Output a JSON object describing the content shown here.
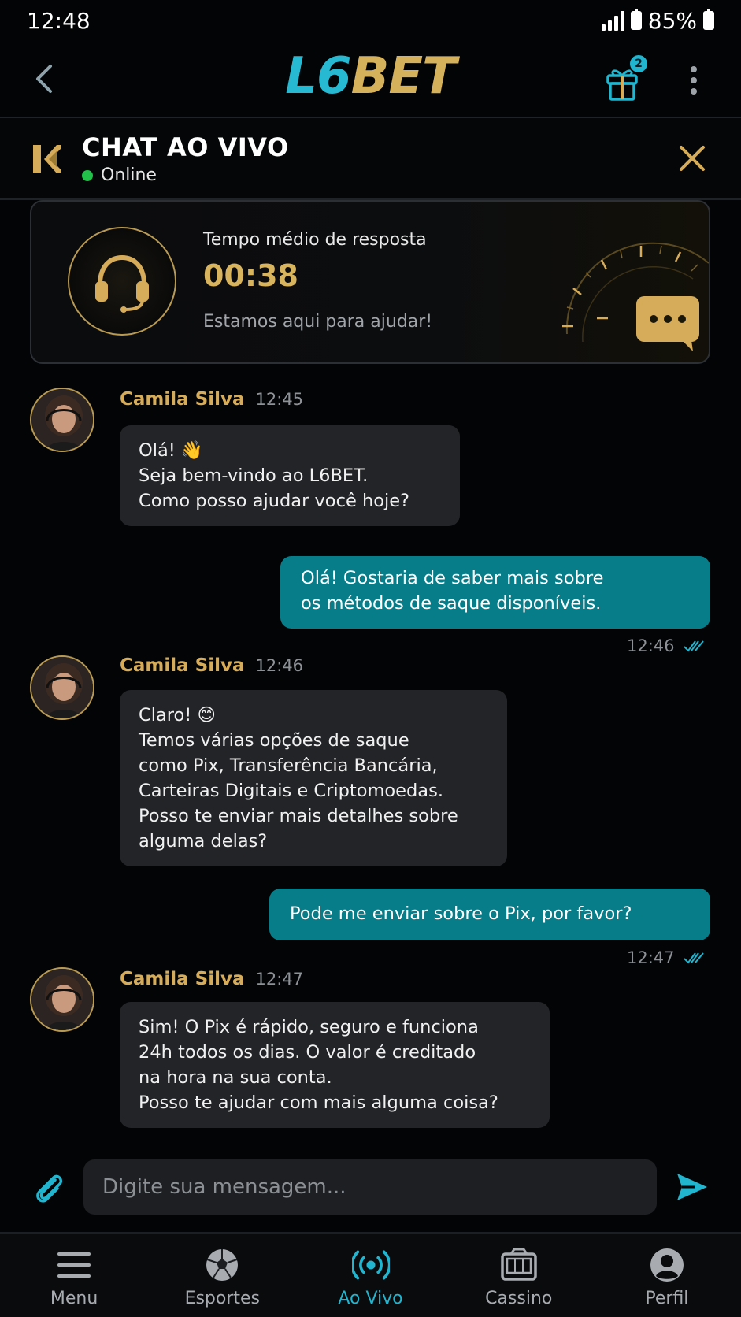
{
  "status_bar": {
    "time": "12:48",
    "battery": "85%"
  },
  "header": {
    "logo_part1": "L6",
    "logo_part2": "BET",
    "gift_badge": "2"
  },
  "chat_header": {
    "title": "CHAT AO VIVO",
    "status": "Online"
  },
  "response_card": {
    "label": "Tempo médio de resposta",
    "time": "00:38",
    "subtitle": "Estamos aqui para ajudar!"
  },
  "messages": [
    {
      "type": "incoming",
      "name": "Camila Silva",
      "time": "12:45",
      "lines": [
        "Olá! 👋",
        "Seja bem-vindo ao L6BET.",
        "Como posso ajudar você hoje?"
      ]
    },
    {
      "type": "outgoing",
      "time": "12:46",
      "lines": [
        "Olá! Gostaria de saber mais sobre",
        "os métodos de saque disponíveis."
      ]
    },
    {
      "type": "incoming",
      "name": "Camila Silva",
      "time": "12:46",
      "lines": [
        "Claro! 😊",
        "Temos várias opções de saque",
        "como Pix, Transferência Bancária,",
        "Carteiras Digitais e Criptomoedas.",
        "Posso te enviar mais detalhes sobre",
        "alguma delas?"
      ]
    },
    {
      "type": "outgoing",
      "time": "12:47",
      "lines": [
        "Pode me enviar sobre o Pix, por favor?"
      ]
    },
    {
      "type": "incoming",
      "name": "Camila Silva",
      "time": "12:47",
      "lines": [
        "Sim! O Pix é rápido, seguro e funciona",
        "24h todos os dias. O valor é creditado",
        "na hora na sua conta.",
        "Posso te ajudar com mais alguma coisa?"
      ]
    }
  ],
  "input": {
    "placeholder": "Digite sua mensagem..."
  },
  "nav": [
    {
      "label": "Menu",
      "icon": "menu-icon",
      "active": false
    },
    {
      "label": "Esportes",
      "icon": "soccer-ball-icon",
      "active": false
    },
    {
      "label": "Ao Vivo",
      "icon": "live-broadcast-icon",
      "active": true
    },
    {
      "label": "Cassino",
      "icon": "slot-machine-icon",
      "active": false
    },
    {
      "label": "Perfil",
      "icon": "user-icon",
      "active": false
    }
  ],
  "colors": {
    "accent_teal": "#21b5cf",
    "accent_gold": "#d6ac5a",
    "outgoing_bubble": "#087d8a",
    "incoming_bubble": "#222427",
    "background": "#030405"
  }
}
